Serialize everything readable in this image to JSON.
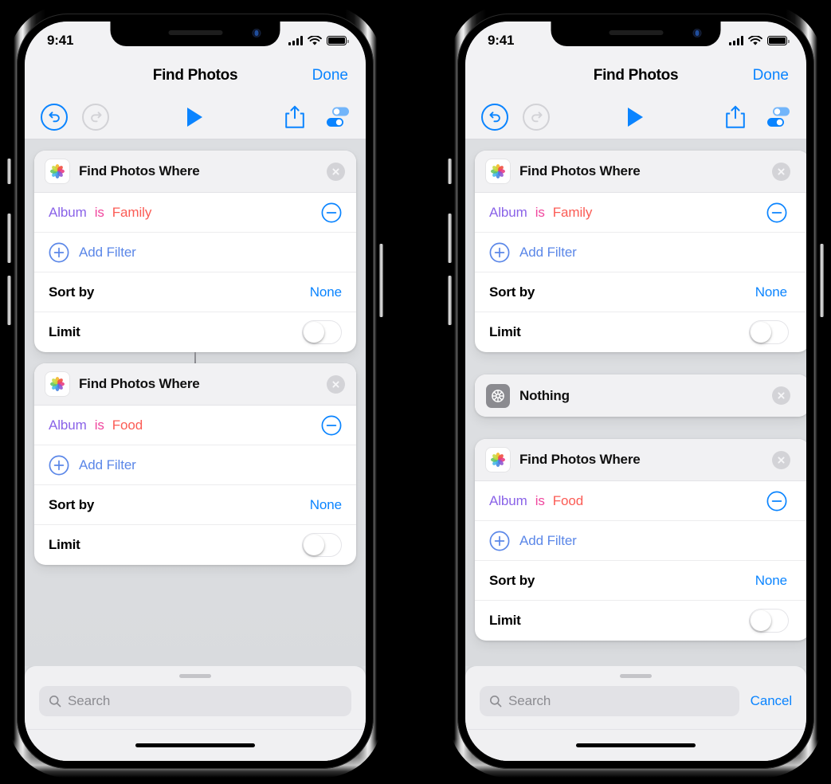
{
  "screens": [
    {
      "id": "left",
      "status_bar": {
        "time": "9:41",
        "signal_icon": "cellular-bars-icon",
        "wifi_icon": "wifi-icon",
        "battery_icon": "battery-icon"
      },
      "nav": {
        "title": "Find Photos",
        "done_label": "Done"
      },
      "toolbar": {
        "undo_icon": "undo-icon",
        "redo_icon": "redo-icon",
        "play_icon": "play-icon",
        "share_icon": "share-icon",
        "settings_icon": "shortcut-settings-toggles-icon"
      },
      "cards": [
        {
          "type": "find-photos",
          "icon": "photos-app-icon",
          "title": "Find Photos Where",
          "close_icon": "close-circle-icon",
          "filters": [
            {
              "field": "Album",
              "operator": "is",
              "value": "Family",
              "remove_icon": "minus-circle-icon"
            }
          ],
          "add_filter_label": "Add Filter",
          "add_filter_icon": "plus-circle-icon",
          "sort_by_label": "Sort by",
          "sort_by_value": "None",
          "limit_label": "Limit",
          "limit_enabled": false
        },
        {
          "type": "find-photos",
          "icon": "photos-app-icon",
          "title": "Find Photos Where",
          "close_icon": "close-circle-icon",
          "filters": [
            {
              "field": "Album",
              "operator": "is",
              "value": "Food",
              "remove_icon": "minus-circle-icon"
            }
          ],
          "add_filter_label": "Add Filter",
          "add_filter_icon": "plus-circle-icon",
          "sort_by_label": "Sort by",
          "sort_by_value": "None",
          "limit_label": "Limit",
          "limit_enabled": false
        }
      ],
      "search": {
        "placeholder": "Search",
        "search_icon": "search-icon",
        "cancel_label": "",
        "show_cancel": false
      },
      "home_indicator": "home-indicator"
    },
    {
      "id": "right",
      "status_bar": {
        "time": "9:41",
        "signal_icon": "cellular-bars-icon",
        "wifi_icon": "wifi-icon",
        "battery_icon": "battery-icon"
      },
      "nav": {
        "title": "Find Photos",
        "done_label": "Done"
      },
      "toolbar": {
        "undo_icon": "undo-icon",
        "redo_icon": "redo-icon",
        "play_icon": "play-icon",
        "share_icon": "share-icon",
        "settings_icon": "shortcut-settings-toggles-icon"
      },
      "cards": [
        {
          "type": "find-photos",
          "icon": "photos-app-icon",
          "title": "Find Photos Where",
          "close_icon": "close-circle-icon",
          "filters": [
            {
              "field": "Album",
              "operator": "is",
              "value": "Family",
              "remove_icon": "minus-circle-icon"
            }
          ],
          "add_filter_label": "Add Filter",
          "add_filter_icon": "plus-circle-icon",
          "sort_by_label": "Sort by",
          "sort_by_value": "None",
          "limit_label": "Limit",
          "limit_enabled": false
        },
        {
          "type": "nothing",
          "icon": "gear-icon",
          "title": "Nothing",
          "close_icon": "close-circle-icon"
        },
        {
          "type": "find-photos",
          "icon": "photos-app-icon",
          "title": "Find Photos Where",
          "close_icon": "close-circle-icon",
          "filters": [
            {
              "field": "Album",
              "operator": "is",
              "value": "Food",
              "remove_icon": "minus-circle-icon"
            }
          ],
          "add_filter_label": "Add Filter",
          "add_filter_icon": "plus-circle-icon",
          "sort_by_label": "Sort by",
          "sort_by_value": "None",
          "limit_label": "Limit",
          "limit_enabled": false
        }
      ],
      "search": {
        "placeholder": "Search",
        "search_icon": "search-icon",
        "cancel_label": "Cancel",
        "show_cancel": true
      },
      "home_indicator": "home-indicator"
    }
  ],
  "colors": {
    "accent_blue": "#0a84ff",
    "field_purple": "#8a63e8",
    "operator_pink": "#f0469e",
    "value_red": "#fb5c55",
    "canvas_gray": "#dcdee1",
    "card_white": "#ffffff",
    "card_header_gray": "#f1f1f3",
    "gear_icon_gray": "#8b8b90"
  }
}
